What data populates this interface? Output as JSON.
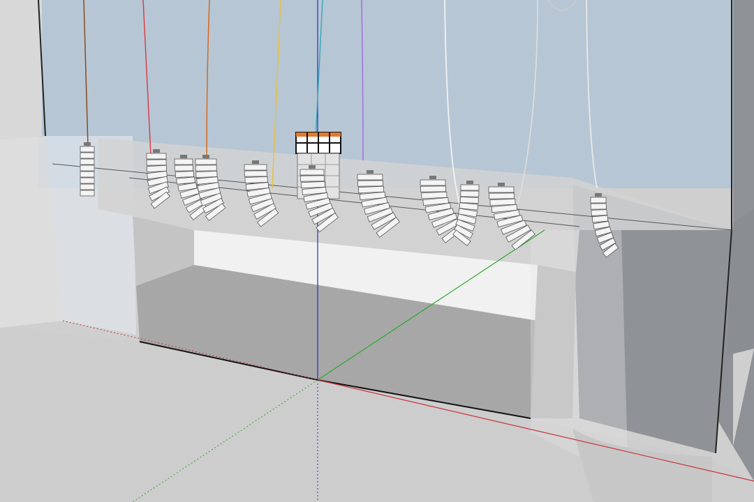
{
  "viewport": {
    "label": "",
    "colors": {
      "sky": "#b6c6d4",
      "ground": "#cfcfcf",
      "wall_light": "#e4e4e4",
      "wall_mid": "#c6c6c6",
      "stage_floor": "#a7a7a7",
      "stage_back": "#f1f1f1",
      "right_block": "#8e9296",
      "axis_red": "#c8323a",
      "axis_green": "#2da82d",
      "axis_blue": "#2a2ac8",
      "glass": "#dfe6ec"
    },
    "cables": [
      {
        "name": "brown",
        "color": "#8a4a20"
      },
      {
        "name": "red",
        "color": "#d8404a"
      },
      {
        "name": "black-orange",
        "color": "#d2691e"
      },
      {
        "name": "yellow",
        "color": "#e8c040"
      },
      {
        "name": "teal",
        "color": "#3aa8b8"
      },
      {
        "name": "purple",
        "color": "#a070e0"
      },
      {
        "name": "white",
        "color": "#f2f2f2"
      },
      {
        "name": "grey",
        "color": "#dcdcdc"
      }
    ],
    "speaker_arrays": [
      {
        "id": "array-1"
      },
      {
        "id": "array-2"
      },
      {
        "id": "array-3"
      },
      {
        "id": "array-4"
      },
      {
        "id": "array-5"
      },
      {
        "id": "array-6"
      },
      {
        "id": "array-7"
      },
      {
        "id": "array-8"
      },
      {
        "id": "array-9"
      },
      {
        "id": "array-10"
      },
      {
        "id": "array-11"
      }
    ],
    "cube_stack": {
      "accent": "#e07a30"
    }
  }
}
